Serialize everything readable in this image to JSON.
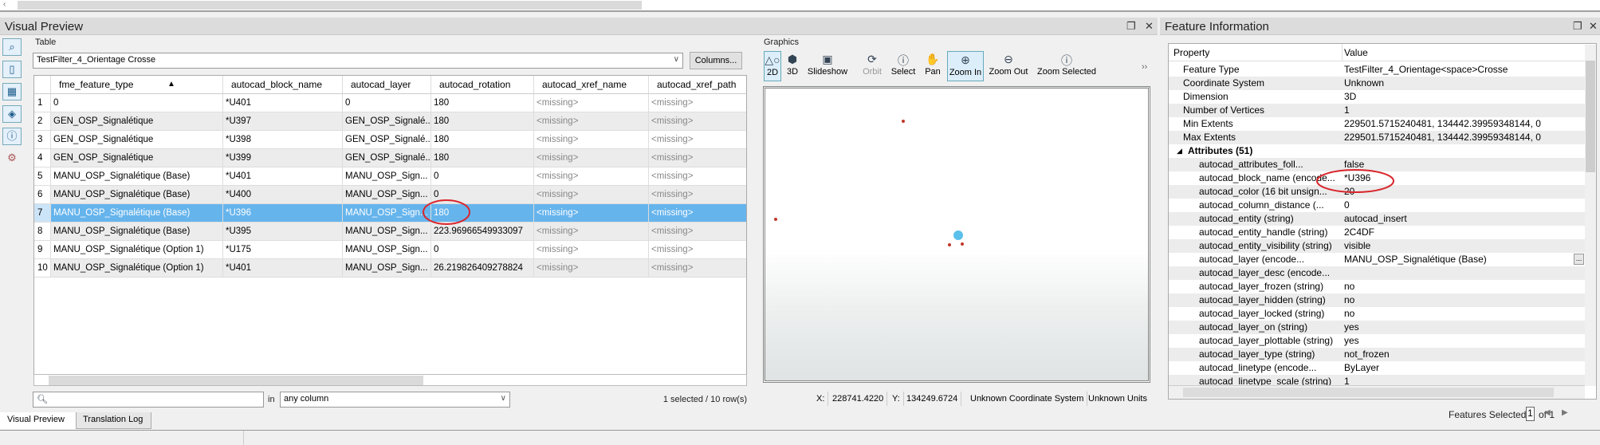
{
  "visual_preview": {
    "title": "Visual Preview",
    "table_label": "Table",
    "table_select": "TestFilter_4_Orientage Crosse",
    "columns_button": "Columns...",
    "columns": [
      "fme_feature_type",
      "autocad_block_name",
      "autocad_layer",
      "autocad_rotation",
      "autocad_xref_name",
      "autocad_xref_path"
    ],
    "sort_indicator": "▲",
    "rows": [
      {
        "n": "1",
        "c": [
          "0",
          "*U401",
          "0",
          "180",
          "<missing>",
          "<missing>"
        ]
      },
      {
        "n": "2",
        "c": [
          "GEN_OSP_Signalétique",
          "*U397",
          "GEN_OSP_Signalé...",
          "180",
          "<missing>",
          "<missing>"
        ]
      },
      {
        "n": "3",
        "c": [
          "GEN_OSP_Signalétique",
          "*U398",
          "GEN_OSP_Signalé...",
          "180",
          "<missing>",
          "<missing>"
        ]
      },
      {
        "n": "4",
        "c": [
          "GEN_OSP_Signalétique",
          "*U399",
          "GEN_OSP_Signalé...",
          "180",
          "<missing>",
          "<missing>"
        ]
      },
      {
        "n": "5",
        "c": [
          "MANU_OSP_Signalétique (Base)",
          "*U401",
          "MANU_OSP_Sign...",
          "0",
          "<missing>",
          "<missing>"
        ]
      },
      {
        "n": "6",
        "c": [
          "MANU_OSP_Signalétique (Base)",
          "*U400",
          "MANU_OSP_Sign...",
          "0",
          "<missing>",
          "<missing>"
        ]
      },
      {
        "n": "7",
        "c": [
          "MANU_OSP_Signalétique (Base)",
          "*U396",
          "MANU_OSP_Sign...",
          "180",
          "<missing>",
          "<missing>"
        ],
        "selected": true
      },
      {
        "n": "8",
        "c": [
          "MANU_OSP_Signalétique (Base)",
          "*U395",
          "MANU_OSP_Sign...",
          "223.96966549933097",
          "<missing>",
          "<missing>"
        ]
      },
      {
        "n": "9",
        "c": [
          "MANU_OSP_Signalétique (Option 1)",
          "*U175",
          "MANU_OSP_Sign...",
          "0",
          "<missing>",
          "<missing>"
        ]
      },
      {
        "n": "10",
        "c": [
          "MANU_OSP_Signalétique (Option 1)",
          "*U401",
          "MANU_OSP_Sign...",
          "26.219826409278824",
          "<missing>",
          "<missing>"
        ]
      }
    ],
    "search_placeholder": "",
    "in_label": "in",
    "search_column": "any column",
    "selection_status": "1 selected / 10 row(s)"
  },
  "graphics": {
    "label": "Graphics",
    "tools": [
      {
        "label": "2D",
        "icon": "2d-shapes-icon",
        "active": true
      },
      {
        "label": "3D",
        "icon": "3d-icon"
      },
      {
        "label": "Slideshow",
        "icon": "slideshow-icon"
      },
      {
        "label": "Orbit",
        "icon": "orbit-icon",
        "disabled": true
      },
      {
        "label": "Select",
        "icon": "select-info-icon"
      },
      {
        "label": "Pan",
        "icon": "hand-icon"
      },
      {
        "label": "Zoom In",
        "icon": "zoom-in-icon",
        "active": true
      },
      {
        "label": "Zoom Out",
        "icon": "zoom-out-icon"
      },
      {
        "label": "Zoom Selected",
        "icon": "zoom-selected-icon"
      }
    ],
    "more": "››",
    "status": {
      "x_label": "X:",
      "x": "228741.4220",
      "y_label": "Y:",
      "y": "134249.6724",
      "coord_sys": "Unknown Coordinate System",
      "units": "Unknown Units"
    },
    "point_color": "#c0392b",
    "selected_color": "#5bc0eb"
  },
  "tabs": [
    "Visual Preview",
    "Translation Log"
  ],
  "feature_info": {
    "title": "Feature Information",
    "header": {
      "property": "Property",
      "value": "Value"
    },
    "rows": [
      {
        "p": "Feature Type",
        "v": "TestFilter_4_Orientage<space>Crosse"
      },
      {
        "p": "Coordinate System",
        "v": "Unknown"
      },
      {
        "p": "Dimension",
        "v": "3D"
      },
      {
        "p": "Number of Vertices",
        "v": "1"
      },
      {
        "p": "Min Extents",
        "v": "229501.5715240481, 134442.39959348144, 0"
      },
      {
        "p": "Max Extents",
        "v": "229501.5715240481, 134442.39959348144, 0"
      },
      {
        "p": "Attributes (51)",
        "v": "",
        "group": true
      },
      {
        "p": "autocad_attributes_foll...",
        "v": "false",
        "attr": true
      },
      {
        "p": "autocad_block_name (encode...",
        "v": "*U396",
        "attr": true
      },
      {
        "p": "autocad_color (16 bit unsign...",
        "v": "20",
        "attr": true
      },
      {
        "p": "autocad_column_distance (...",
        "v": "0",
        "attr": true
      },
      {
        "p": "autocad_entity (string)",
        "v": "autocad_insert",
        "attr": true
      },
      {
        "p": "autocad_entity_handle (string)",
        "v": "2C4DF",
        "attr": true
      },
      {
        "p": "autocad_entity_visibility (string)",
        "v": "visible",
        "attr": true
      },
      {
        "p": "autocad_layer (encode...",
        "v": "MANU_OSP_Signalétique (Base)",
        "attr": true,
        "more": "..."
      },
      {
        "p": "autocad_layer_desc (encode...",
        "v": "",
        "attr": true
      },
      {
        "p": "autocad_layer_frozen (string)",
        "v": "no",
        "attr": true
      },
      {
        "p": "autocad_layer_hidden (string)",
        "v": "no",
        "attr": true
      },
      {
        "p": "autocad_layer_locked (string)",
        "v": "no",
        "attr": true
      },
      {
        "p": "autocad_layer_on (string)",
        "v": "yes",
        "attr": true
      },
      {
        "p": "autocad_layer_plottable (string)",
        "v": "yes",
        "attr": true
      },
      {
        "p": "autocad_layer_type (string)",
        "v": "not_frozen",
        "attr": true
      },
      {
        "p": "autocad_linetype (encode...",
        "v": "ByLayer",
        "attr": true
      },
      {
        "p": "autocad_linetype_scale (string)",
        "v": "1",
        "attr": true
      }
    ],
    "features_selected_label": "Features Selected:",
    "features_selected": "1",
    "of_label": "of 1"
  },
  "annotation_color": "#d9262c"
}
